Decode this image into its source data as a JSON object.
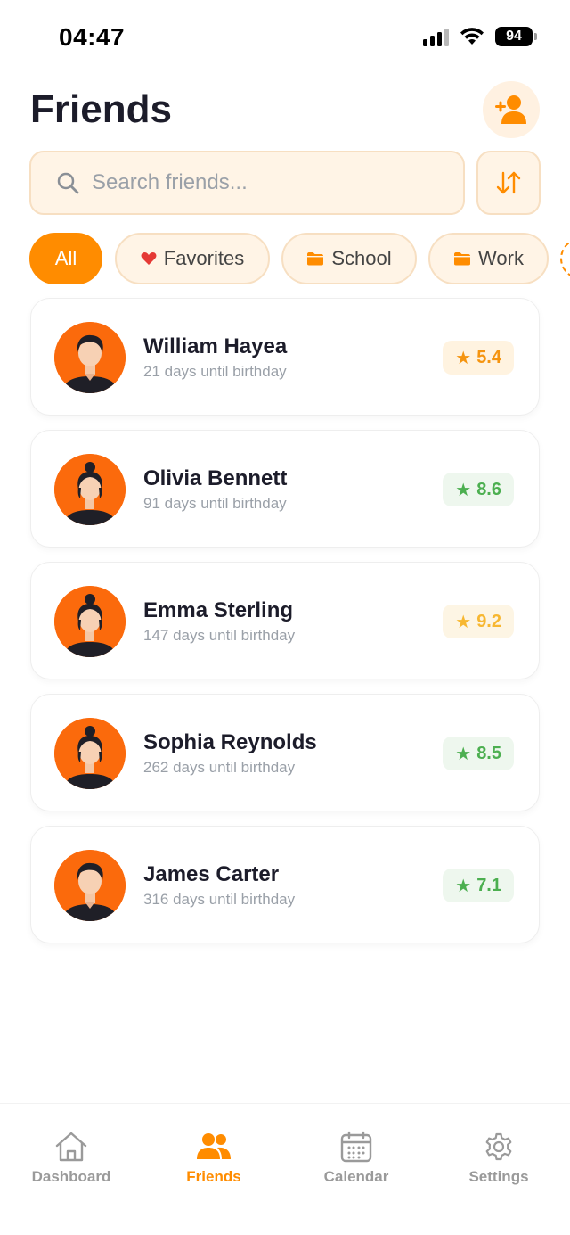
{
  "status_bar": {
    "time": "04:47",
    "battery": "94"
  },
  "header": {
    "title": "Friends"
  },
  "search": {
    "placeholder": "Search friends..."
  },
  "filters": [
    {
      "label": "All",
      "icon": "none",
      "active": true
    },
    {
      "label": "Favorites",
      "icon": "heart-icon",
      "active": false
    },
    {
      "label": "School",
      "icon": "folder-icon",
      "active": false
    },
    {
      "label": "Work",
      "icon": "folder-icon",
      "active": false
    }
  ],
  "friends": [
    {
      "name": "William Hayea",
      "subtitle": "21 days until birthday",
      "rating": "5.4",
      "rating_color": "orange",
      "avatar": "male-avatar"
    },
    {
      "name": "Olivia Bennett",
      "subtitle": "91 days until birthday",
      "rating": "8.6",
      "rating_color": "green",
      "avatar": "female-avatar"
    },
    {
      "name": "Emma Sterling",
      "subtitle": "147 days until birthday",
      "rating": "9.2",
      "rating_color": "yellow",
      "avatar": "female-avatar"
    },
    {
      "name": "Sophia Reynolds",
      "subtitle": "262 days until birthday",
      "rating": "8.5",
      "rating_color": "green",
      "avatar": "female-avatar"
    },
    {
      "name": "James Carter",
      "subtitle": "316 days until birthday",
      "rating": "7.1",
      "rating_color": "green",
      "avatar": "male-avatar"
    }
  ],
  "nav": [
    {
      "label": "Dashboard",
      "icon": "home-icon",
      "active": false
    },
    {
      "label": "Friends",
      "icon": "people-icon",
      "active": true
    },
    {
      "label": "Calendar",
      "icon": "calendar-icon",
      "active": false
    },
    {
      "label": "Settings",
      "icon": "gear-icon",
      "active": false
    }
  ],
  "colors": {
    "accent": "#ff8c00",
    "avatar_bg": "#fb6a0c",
    "heart": "#e53935"
  }
}
